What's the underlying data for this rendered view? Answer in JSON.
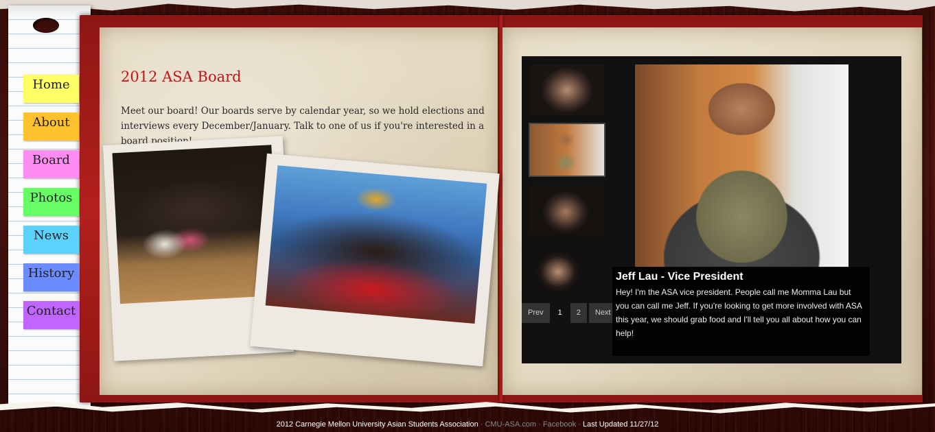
{
  "nav": {
    "items": [
      {
        "label": "Home",
        "color": "#ffff66"
      },
      {
        "label": "About",
        "color": "#ffc12e"
      },
      {
        "label": "Board",
        "color": "#ff8cf2"
      },
      {
        "label": "Photos",
        "color": "#66ff66"
      },
      {
        "label": "News",
        "color": "#5cd3ff"
      },
      {
        "label": "History",
        "color": "#6b8cff"
      },
      {
        "label": "Contact",
        "color": "#c065ff"
      }
    ]
  },
  "content": {
    "title": "2012 ASA Board",
    "intro": "Meet our board! Our boards serve by calendar year, so we hold elections and interviews every December/January. Talk to one of us if you're interested in a board position!"
  },
  "gallery": {
    "pager": {
      "prev": "Prev",
      "pages": [
        "1",
        "2"
      ],
      "current": "1",
      "next": "Next"
    },
    "caption": {
      "name": "Jeff Lau - Vice President",
      "description": "Hey! I'm the ASA vice president. People call me Momma Lau but you can call me Jeff. If you're looking to get more involved with ASA this year, we should grab food and I'll tell you all about how you can help!"
    }
  },
  "footer": {
    "copyright": "2012 Carnegie Mellon University Asian Students Association",
    "site_link": "CMU-ASA.com",
    "facebook_link": "Facebook",
    "updated": "Last Updated 11/27/12",
    "separator": " · "
  },
  "colors": {
    "title_red": "#c2141b",
    "book_red": "#b3201c",
    "page_paper": "#e4d9c1",
    "gallery_bg": "#111111"
  }
}
